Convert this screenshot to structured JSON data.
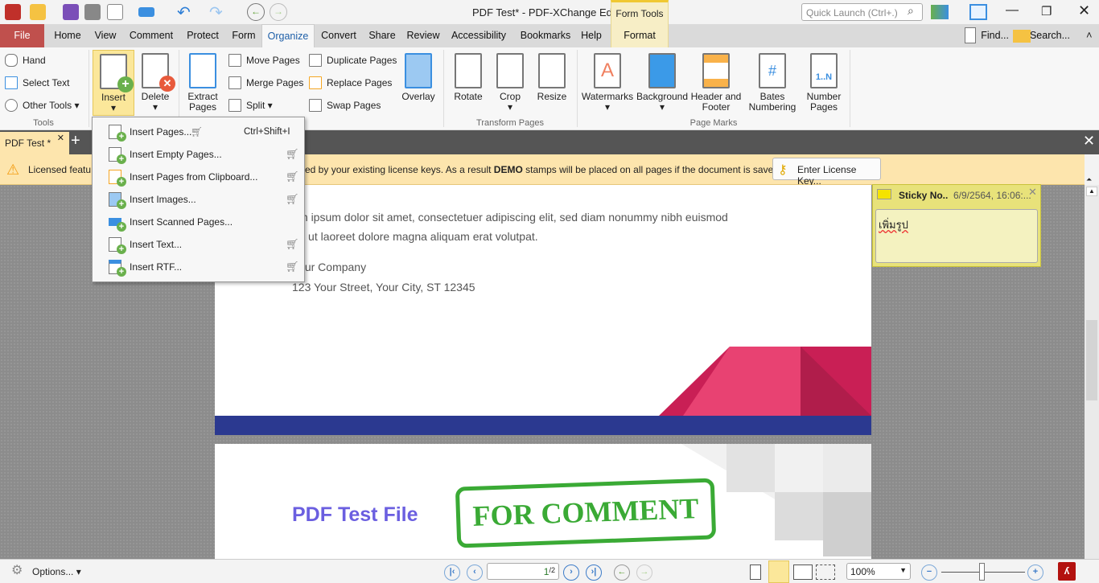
{
  "window": {
    "title": "PDF Test* - PDF-XChange Editor",
    "contextual_group": "Form Tools",
    "quick_launch_placeholder": "Quick Launch (Ctrl+.)"
  },
  "menu_tabs": [
    "File",
    "Home",
    "View",
    "Comment",
    "Protect",
    "Form",
    "Organize",
    "Convert",
    "Share",
    "Review",
    "Accessibility",
    "Bookmarks",
    "Help",
    "Format"
  ],
  "active_tab": "Organize",
  "right_tools": {
    "find": "Find...",
    "search": "Search..."
  },
  "ribbon": {
    "tools": {
      "hand": "Hand",
      "select_text": "Select Text",
      "other_tools": "Other Tools",
      "group": "Tools"
    },
    "pages": {
      "insert": "Insert",
      "delete": "Delete",
      "extract": "Extract Pages",
      "move": "Move Pages",
      "merge": "Merge Pages",
      "split": "Split",
      "duplicate": "Duplicate Pages",
      "replace": "Replace Pages",
      "swap": "Swap Pages",
      "overlay": "Overlay"
    },
    "transform": {
      "rotate": "Rotate",
      "crop": "Crop",
      "resize": "Resize",
      "group": "Transform Pages"
    },
    "marks": {
      "watermarks": "Watermarks",
      "background": "Background",
      "header_footer": "Header and Footer",
      "bates": "Bates Numbering",
      "number_pages": "Number Pages",
      "group": "Page Marks"
    }
  },
  "insert_menu": [
    {
      "label": "Insert Pages...",
      "shortcut": "Ctrl+Shift+I",
      "cart": true
    },
    {
      "label": "Insert Empty Pages...",
      "cart": true
    },
    {
      "label": "Insert Pages from Clipboard...",
      "cart": true
    },
    {
      "label": "Insert Images...",
      "cart": true
    },
    {
      "label": "Insert Scanned Pages...",
      "cart": false
    },
    {
      "label": "Insert Text...",
      "cart": true
    },
    {
      "label": "Insert RTF...",
      "cart": true
    }
  ],
  "doc_tab": {
    "label": "PDF Test *"
  },
  "warning": {
    "prefix": "Licensed featu",
    "middle": "ed by your existing license keys. As a result ",
    "bold": "DEMO",
    "suffix": " stamps will be placed on all pages if the document is saved.",
    "button": "Enter License Key..."
  },
  "page1": {
    "line1": "Lorem ipsum dolor sit amet, consectetuer adipiscing elit, sed diam nonummy nibh euismod",
    "line2": "tincidunt ut laoreet dolore magna aliquam erat volutpat.",
    "company": "Your Company",
    "address": "123 Your Street, Your City, ST 12345"
  },
  "page2": {
    "title": "PDF Test File",
    "stamp": "FOR COMMENT"
  },
  "sticky": {
    "title": "Sticky No..",
    "date": "6/9/2564, 16:06:...",
    "text": "เพิ่มรูป"
  },
  "status": {
    "options": "Options...",
    "page": "1",
    "total": "/2",
    "zoom": "100%"
  },
  "colors": {
    "file_tab": "#c0504d",
    "accent": "#2b3990",
    "pink": "#e83e6c",
    "stamp": "#3aaa35",
    "title_purple": "#6b5fe0"
  }
}
